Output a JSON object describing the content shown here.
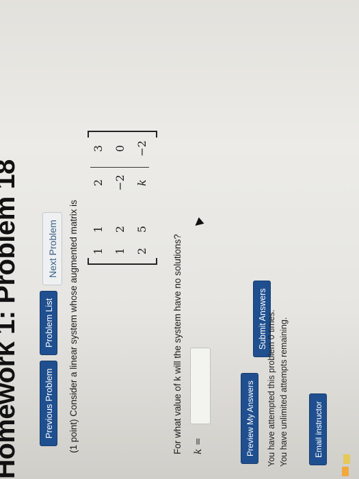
{
  "header": {
    "title": "Homework 1: Problem 18"
  },
  "nav": {
    "previous": "Previous Problem",
    "list": "Problem List",
    "next": "Next Problem"
  },
  "problem": {
    "intro": "(1 point) Consider a linear system whose augmented matrix is",
    "matrix": [
      [
        "1",
        "1",
        "2",
        "3"
      ],
      [
        "1",
        "2",
        "−2",
        "0"
      ],
      [
        "2",
        "5",
        "k",
        "−2"
      ]
    ],
    "question": "For what value of k will the system have no solutions?",
    "answer_label": "k =",
    "answer_value": ""
  },
  "actions": {
    "preview": "Preview My Answers",
    "submit": "Submit Answers"
  },
  "status": {
    "attempted": "You have attempted this problem 0 times.",
    "remaining": "You have unlimited attempts remaining."
  },
  "footer": {
    "email": "Email instructor"
  },
  "colors": {
    "primary_button": "#1f4f8f",
    "page_background": "#ecebe7"
  }
}
